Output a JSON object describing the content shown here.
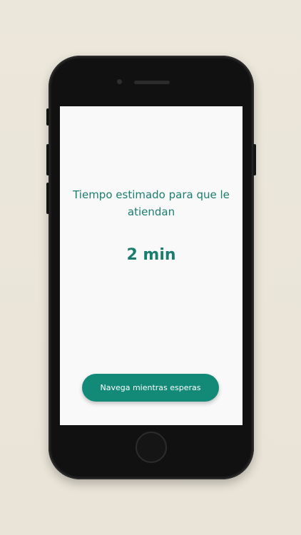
{
  "screen": {
    "wait_label": "Tiempo estimado para que le atiendan",
    "wait_time": "2 min",
    "browse_button_label": "Navega mientras esperas"
  },
  "colors": {
    "accent": "#1a7d6e",
    "button": "#138a78",
    "background": "#ebe6da",
    "phone": "#1b1b1b",
    "screen": "#f9f9f9"
  },
  "icons": {
    "home": "home-button-icon",
    "camera": "front-camera-icon",
    "speaker": "earpiece-icon"
  }
}
